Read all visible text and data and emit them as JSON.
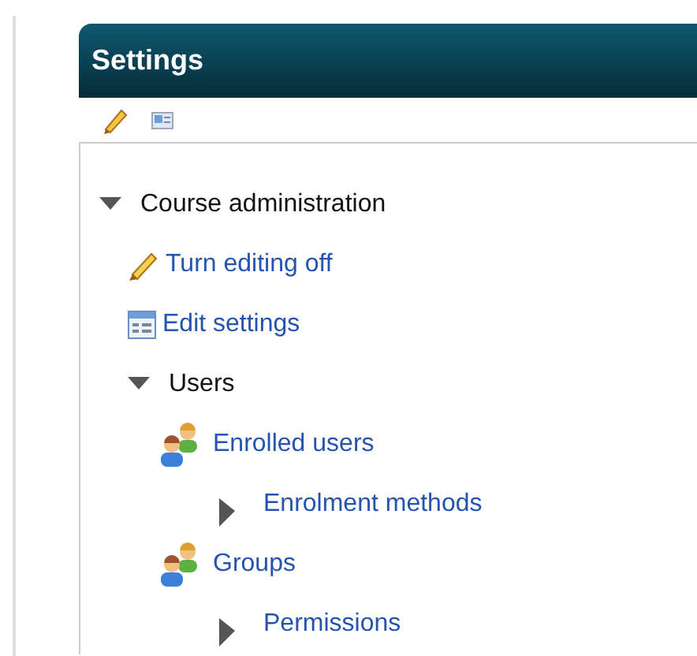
{
  "block": {
    "title": "Settings"
  },
  "tree": [
    {
      "kind": "branch",
      "label": "Course administration",
      "expanded": true,
      "children": [
        {
          "kind": "edit",
          "label": "Turn editing off"
        },
        {
          "kind": "settings",
          "label": "Edit settings"
        },
        {
          "kind": "branch",
          "label": "Users",
          "expanded": true,
          "children": [
            {
              "kind": "users",
              "label": "Enrolled users"
            },
            {
              "kind": "branch",
              "label": "Enrolment methods",
              "expanded": false
            },
            {
              "kind": "users",
              "label": "Groups"
            },
            {
              "kind": "branch",
              "label": "Permissions",
              "expanded": false
            }
          ]
        }
      ]
    }
  ]
}
